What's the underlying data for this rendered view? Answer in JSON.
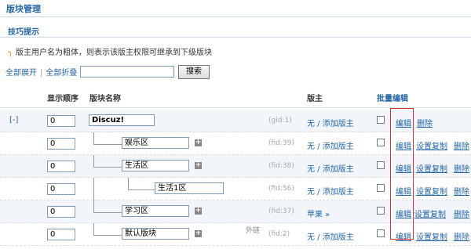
{
  "page": {
    "title": "版块管理"
  },
  "tips": {
    "heading": "技巧提示",
    "items": [
      "版主用户名为粗体，则表示该版主权限可继承到下级版块"
    ]
  },
  "toolbar": {
    "expand_all": "全部展开",
    "separator": "|",
    "collapse_all": "全部折叠",
    "search_value": "",
    "search_button": "搜索"
  },
  "table": {
    "headers": {
      "order": "显示顺序",
      "name": "版块名称",
      "moderator": "版主",
      "batch_edit": "批量编辑"
    },
    "rows": [
      {
        "toggle": "[-]",
        "order": "0",
        "name": "Discuz!",
        "id_label": "(gid:1)",
        "moderator": "无 / 添加版主",
        "edit": "编辑",
        "delete": "删除"
      },
      {
        "order": "0",
        "name": "娱乐区",
        "id_label": "(fid:39)",
        "moderator": "无 / 添加版主",
        "edit": "编辑",
        "copy": "设置复制",
        "delete": "删除"
      },
      {
        "order": "0",
        "name": "生活区",
        "id_label": "(fid:38)",
        "moderator": "无 / 添加版主",
        "edit": "编辑",
        "copy": "设置复制",
        "delete": "删除"
      },
      {
        "order": "0",
        "name": "生活1区",
        "id_label": "(fid:56)",
        "moderator": "无 / 添加版主",
        "edit": "编辑",
        "copy": "设置复制",
        "delete": "删除"
      },
      {
        "order": "0",
        "name": "学习区",
        "id_label": "(fid:37)",
        "moderator": "苹果 »",
        "edit": "编辑",
        "copy": "设置复制",
        "delete": "删除"
      },
      {
        "order": "0",
        "name": "默认版块",
        "outlink": "外链",
        "id_label": "(fid:2)",
        "moderator": "无 / 添加版主",
        "edit": "编辑",
        "copy": "设置复制",
        "delete": "删除"
      }
    ]
  },
  "icons": {
    "tip": "pin-icon",
    "add_sub": "plus-icon"
  },
  "colors": {
    "link": "#2366a8",
    "highlight": "#e03030"
  }
}
